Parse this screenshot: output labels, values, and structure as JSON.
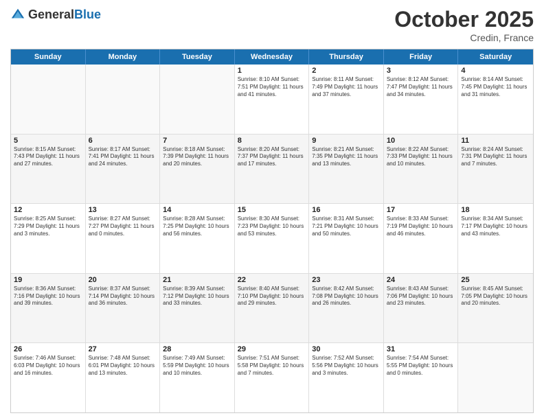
{
  "header": {
    "logo_general": "General",
    "logo_blue": "Blue",
    "month_title": "October 2025",
    "location": "Credin, France"
  },
  "days_of_week": [
    "Sunday",
    "Monday",
    "Tuesday",
    "Wednesday",
    "Thursday",
    "Friday",
    "Saturday"
  ],
  "weeks": [
    [
      {
        "date": "",
        "info": ""
      },
      {
        "date": "",
        "info": ""
      },
      {
        "date": "",
        "info": ""
      },
      {
        "date": "1",
        "info": "Sunrise: 8:10 AM\nSunset: 7:51 PM\nDaylight: 11 hours and 41 minutes."
      },
      {
        "date": "2",
        "info": "Sunrise: 8:11 AM\nSunset: 7:49 PM\nDaylight: 11 hours and 37 minutes."
      },
      {
        "date": "3",
        "info": "Sunrise: 8:12 AM\nSunset: 7:47 PM\nDaylight: 11 hours and 34 minutes."
      },
      {
        "date": "4",
        "info": "Sunrise: 8:14 AM\nSunset: 7:45 PM\nDaylight: 11 hours and 31 minutes."
      }
    ],
    [
      {
        "date": "5",
        "info": "Sunrise: 8:15 AM\nSunset: 7:43 PM\nDaylight: 11 hours and 27 minutes."
      },
      {
        "date": "6",
        "info": "Sunrise: 8:17 AM\nSunset: 7:41 PM\nDaylight: 11 hours and 24 minutes."
      },
      {
        "date": "7",
        "info": "Sunrise: 8:18 AM\nSunset: 7:39 PM\nDaylight: 11 hours and 20 minutes."
      },
      {
        "date": "8",
        "info": "Sunrise: 8:20 AM\nSunset: 7:37 PM\nDaylight: 11 hours and 17 minutes."
      },
      {
        "date": "9",
        "info": "Sunrise: 8:21 AM\nSunset: 7:35 PM\nDaylight: 11 hours and 13 minutes."
      },
      {
        "date": "10",
        "info": "Sunrise: 8:22 AM\nSunset: 7:33 PM\nDaylight: 11 hours and 10 minutes."
      },
      {
        "date": "11",
        "info": "Sunrise: 8:24 AM\nSunset: 7:31 PM\nDaylight: 11 hours and 7 minutes."
      }
    ],
    [
      {
        "date": "12",
        "info": "Sunrise: 8:25 AM\nSunset: 7:29 PM\nDaylight: 11 hours and 3 minutes."
      },
      {
        "date": "13",
        "info": "Sunrise: 8:27 AM\nSunset: 7:27 PM\nDaylight: 11 hours and 0 minutes."
      },
      {
        "date": "14",
        "info": "Sunrise: 8:28 AM\nSunset: 7:25 PM\nDaylight: 10 hours and 56 minutes."
      },
      {
        "date": "15",
        "info": "Sunrise: 8:30 AM\nSunset: 7:23 PM\nDaylight: 10 hours and 53 minutes."
      },
      {
        "date": "16",
        "info": "Sunrise: 8:31 AM\nSunset: 7:21 PM\nDaylight: 10 hours and 50 minutes."
      },
      {
        "date": "17",
        "info": "Sunrise: 8:33 AM\nSunset: 7:19 PM\nDaylight: 10 hours and 46 minutes."
      },
      {
        "date": "18",
        "info": "Sunrise: 8:34 AM\nSunset: 7:17 PM\nDaylight: 10 hours and 43 minutes."
      }
    ],
    [
      {
        "date": "19",
        "info": "Sunrise: 8:36 AM\nSunset: 7:16 PM\nDaylight: 10 hours and 39 minutes."
      },
      {
        "date": "20",
        "info": "Sunrise: 8:37 AM\nSunset: 7:14 PM\nDaylight: 10 hours and 36 minutes."
      },
      {
        "date": "21",
        "info": "Sunrise: 8:39 AM\nSunset: 7:12 PM\nDaylight: 10 hours and 33 minutes."
      },
      {
        "date": "22",
        "info": "Sunrise: 8:40 AM\nSunset: 7:10 PM\nDaylight: 10 hours and 29 minutes."
      },
      {
        "date": "23",
        "info": "Sunrise: 8:42 AM\nSunset: 7:08 PM\nDaylight: 10 hours and 26 minutes."
      },
      {
        "date": "24",
        "info": "Sunrise: 8:43 AM\nSunset: 7:06 PM\nDaylight: 10 hours and 23 minutes."
      },
      {
        "date": "25",
        "info": "Sunrise: 8:45 AM\nSunset: 7:05 PM\nDaylight: 10 hours and 20 minutes."
      }
    ],
    [
      {
        "date": "26",
        "info": "Sunrise: 7:46 AM\nSunset: 6:03 PM\nDaylight: 10 hours and 16 minutes."
      },
      {
        "date": "27",
        "info": "Sunrise: 7:48 AM\nSunset: 6:01 PM\nDaylight: 10 hours and 13 minutes."
      },
      {
        "date": "28",
        "info": "Sunrise: 7:49 AM\nSunset: 5:59 PM\nDaylight: 10 hours and 10 minutes."
      },
      {
        "date": "29",
        "info": "Sunrise: 7:51 AM\nSunset: 5:58 PM\nDaylight: 10 hours and 7 minutes."
      },
      {
        "date": "30",
        "info": "Sunrise: 7:52 AM\nSunset: 5:56 PM\nDaylight: 10 hours and 3 minutes."
      },
      {
        "date": "31",
        "info": "Sunrise: 7:54 AM\nSunset: 5:55 PM\nDaylight: 10 hours and 0 minutes."
      },
      {
        "date": "",
        "info": ""
      }
    ]
  ]
}
